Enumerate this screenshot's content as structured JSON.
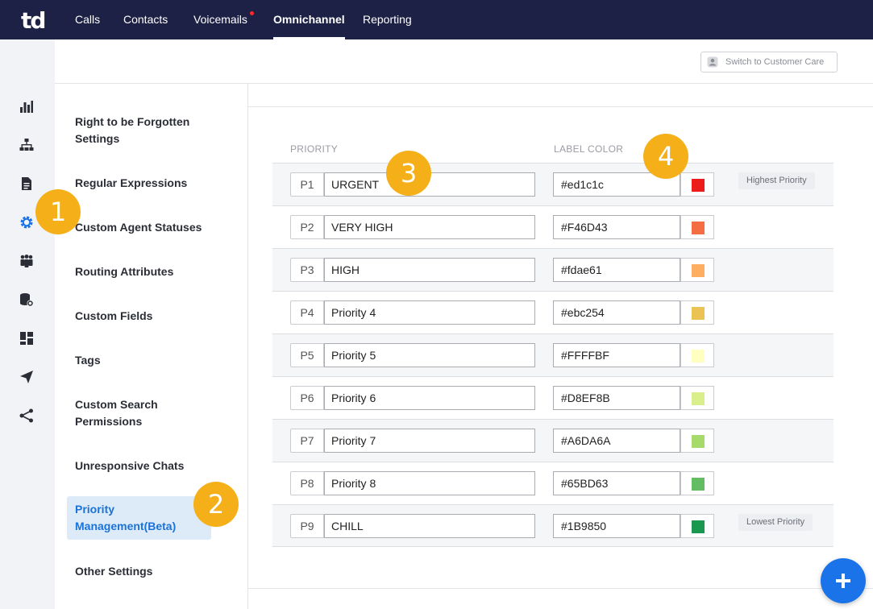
{
  "app": {
    "logo": "td"
  },
  "nav": [
    {
      "label": "Calls"
    },
    {
      "label": "Contacts"
    },
    {
      "label": "Voicemails",
      "notification": true
    },
    {
      "label": "Omnichannel",
      "active": true
    },
    {
      "label": "Reporting"
    }
  ],
  "rail_icons": [
    "bar-chart-icon",
    "org-chart-icon",
    "document-icon",
    "gear-icon",
    "team-icon",
    "database-settings-icon",
    "dashboard-icon",
    "send-icon",
    "share-icon"
  ],
  "header": {
    "switch_label": "Switch to Customer Care"
  },
  "menu": {
    "items": [
      {
        "label": "Right to be Forgotten Settings"
      },
      {
        "label": "Regular Expressions"
      },
      {
        "label": "Custom Agent Statuses"
      },
      {
        "label": "Routing Attributes"
      },
      {
        "label": "Custom Fields"
      },
      {
        "label": "Tags"
      },
      {
        "label": "Custom Search Permissions"
      },
      {
        "label": "Unresponsive Chats"
      },
      {
        "label": "Priority Management(Beta)",
        "active": true
      },
      {
        "label": "Other Settings"
      }
    ]
  },
  "table": {
    "headers": {
      "priority": "PRIORITY",
      "label_color": "LABEL COLOR"
    },
    "rows": [
      {
        "code": "P1",
        "name": "URGENT",
        "color": "#ed1c1c",
        "tag": "Highest Priority"
      },
      {
        "code": "P2",
        "name": "VERY HIGH",
        "color": "#F46D43"
      },
      {
        "code": "P3",
        "name": "HIGH",
        "color": "#fdae61"
      },
      {
        "code": "P4",
        "name": "Priority 4",
        "color": "#ebc254"
      },
      {
        "code": "P5",
        "name": "Priority 5",
        "color": "#FFFFBF"
      },
      {
        "code": "P6",
        "name": "Priority 6",
        "color": "#D8EF8B"
      },
      {
        "code": "P7",
        "name": "Priority 7",
        "color": "#A6DA6A"
      },
      {
        "code": "P8",
        "name": "Priority 8",
        "color": "#65BD63"
      },
      {
        "code": "P9",
        "name": "CHILL",
        "color": "#1B9850",
        "tag": "Lowest Priority"
      }
    ]
  },
  "callouts": [
    "1",
    "2",
    "3",
    "4"
  ],
  "colors": {
    "nav_bg": "#1d2145",
    "accent": "#1a73e8",
    "callout": "#f5b019",
    "active_menu_bg": "#ddeaf8"
  }
}
